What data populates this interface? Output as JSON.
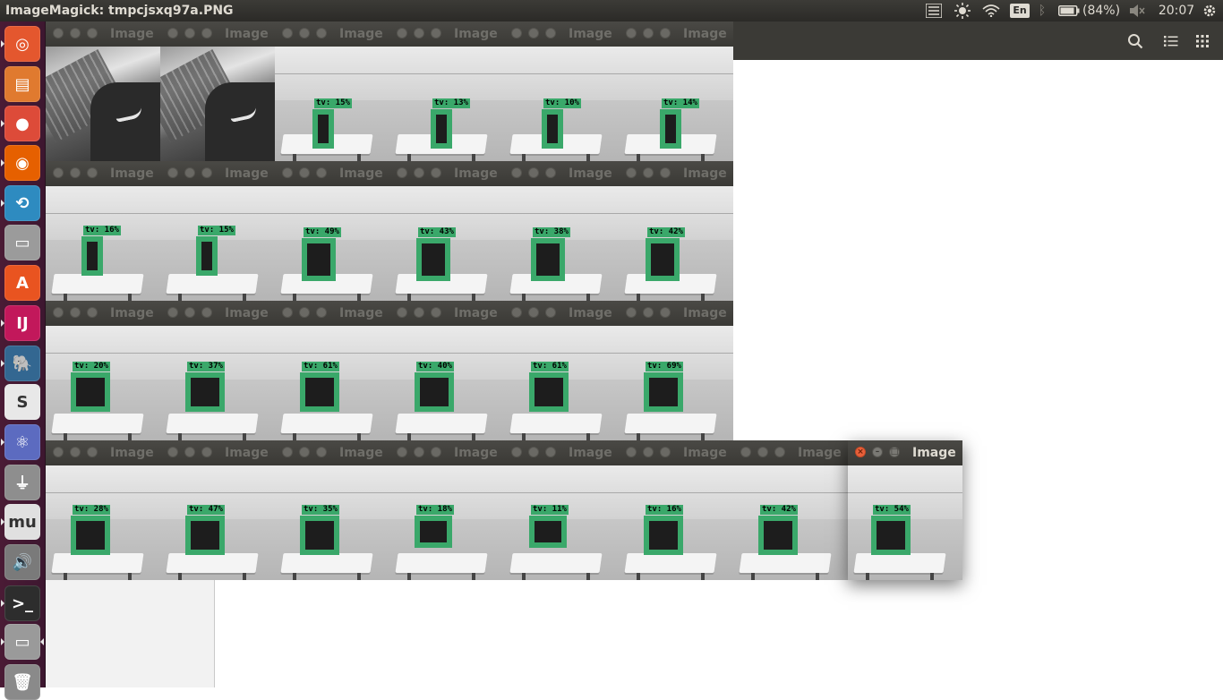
{
  "panel": {
    "title": "ImageMagick: tmpcjsxq97a.PNG",
    "lang": "En",
    "battery": "(84%)",
    "clock": "20:07"
  },
  "launcher": {
    "items": [
      {
        "name": "ubuntu-dash",
        "glyph": "◎",
        "color": "#e4572e"
      },
      {
        "name": "files",
        "glyph": "▤",
        "color": "#e07a2f"
      },
      {
        "name": "chrome",
        "glyph": "●",
        "color": "#dd4b39"
      },
      {
        "name": "firefox",
        "glyph": "◉",
        "color": "#e66000"
      },
      {
        "name": "network",
        "glyph": "⟲",
        "color": "#2e8bc0"
      },
      {
        "name": "drive",
        "glyph": "▭",
        "color": "#9b9b9b"
      },
      {
        "name": "software-center",
        "glyph": "A",
        "color": "#e95420"
      },
      {
        "name": "intellij",
        "glyph": "IJ",
        "color": "#c2185b"
      },
      {
        "name": "postgres",
        "glyph": "🐘",
        "color": "#336791"
      },
      {
        "name": "slack",
        "glyph": "S",
        "color": "#e8e8e8"
      },
      {
        "name": "atom",
        "glyph": "⚛",
        "color": "#5c6bc0"
      },
      {
        "name": "usb",
        "glyph": "⏚",
        "color": "#8e8e8e"
      },
      {
        "name": "musescore",
        "glyph": "mu",
        "color": "#e0e0e0"
      },
      {
        "name": "volume",
        "glyph": "🔊",
        "color": "#7a7a7a"
      },
      {
        "name": "terminal",
        "glyph": ">_",
        "color": "#2d2d2d"
      },
      {
        "name": "display",
        "glyph": "▭",
        "color": "#9a9a9a"
      },
      {
        "name": "trash",
        "glyph": "🗑",
        "color": "#8a8a8a"
      }
    ]
  },
  "window_title": "Image",
  "windows": [
    {
      "row": 0,
      "col": 0,
      "kind": "laptop"
    },
    {
      "row": 0,
      "col": 1,
      "kind": "laptop"
    },
    {
      "row": 0,
      "col": 2,
      "kind": "tv",
      "label": "tv: 15%"
    },
    {
      "row": 0,
      "col": 3,
      "kind": "tv",
      "label": "tv: 13%"
    },
    {
      "row": 0,
      "col": 4,
      "kind": "tv",
      "label": "tv: 10%"
    },
    {
      "row": 0,
      "col": 5,
      "kind": "tv",
      "label": "tv: 14%"
    },
    {
      "row": 1,
      "col": 0,
      "kind": "tv",
      "label": "tv: 16%"
    },
    {
      "row": 1,
      "col": 1,
      "kind": "tv",
      "label": "tv: 15%"
    },
    {
      "row": 1,
      "col": 2,
      "kind": "tv",
      "label": "tv: 49%"
    },
    {
      "row": 1,
      "col": 3,
      "kind": "tv",
      "label": "tv: 43%"
    },
    {
      "row": 1,
      "col": 4,
      "kind": "tv",
      "label": "tv: 38%"
    },
    {
      "row": 1,
      "col": 5,
      "kind": "tv",
      "label": "tv: 42%"
    },
    {
      "row": 2,
      "col": 0,
      "kind": "tv",
      "label": "tv: 20%"
    },
    {
      "row": 2,
      "col": 1,
      "kind": "tv",
      "label": "tv: 37%"
    },
    {
      "row": 2,
      "col": 2,
      "kind": "tv",
      "label": "tv: 61%"
    },
    {
      "row": 2,
      "col": 3,
      "kind": "tv",
      "label": "tv: 40%"
    },
    {
      "row": 2,
      "col": 4,
      "kind": "tv",
      "label": "tv: 61%"
    },
    {
      "row": 2,
      "col": 5,
      "kind": "tv",
      "label": "tv: 69%"
    },
    {
      "row": 3,
      "col": 0,
      "kind": "tv",
      "label": "tv: 28%"
    },
    {
      "row": 3,
      "col": 1,
      "kind": "tv",
      "label": "tv: 47%"
    },
    {
      "row": 3,
      "col": 2,
      "kind": "tv",
      "label": "tv: 35%"
    },
    {
      "row": 3,
      "col": 3,
      "kind": "tv",
      "label": "tv: 18%"
    },
    {
      "row": 3,
      "col": 4,
      "kind": "tv",
      "label": "tv: 11%"
    },
    {
      "row": 3,
      "col": 5,
      "kind": "tv",
      "label": "tv: 16%"
    },
    {
      "row": 3,
      "col": 6,
      "kind": "tv",
      "label": "tv: 42%"
    },
    {
      "row": 3,
      "col": 7,
      "kind": "tv",
      "label": "tv: 54%",
      "active": true
    }
  ],
  "colors": {
    "detection_box": "#3aa86a",
    "close_button_active": "#e9603a"
  }
}
